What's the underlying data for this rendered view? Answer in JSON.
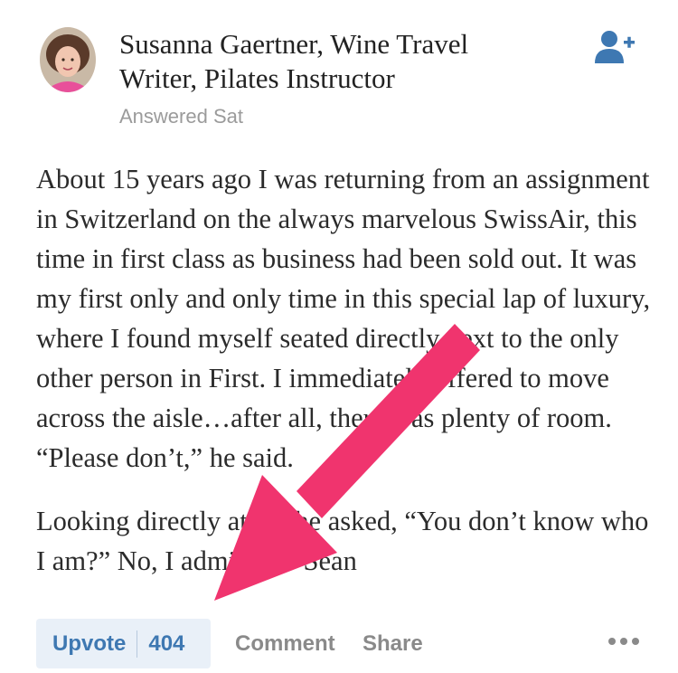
{
  "author": {
    "name": "Susanna Gaertner, Wine Travel Writer, Pilates Instructor",
    "answered": "Answered Sat"
  },
  "icons": {
    "follow": "add-user-icon",
    "more": "more-horizontal-icon"
  },
  "answer": {
    "paragraphs": [
      "About 15 years ago I was returning from an assignment in Switzerland on the always marvelous SwissAir, this time in first class as business had been sold out. It was my first only and only time in this special lap of luxury, where I found myself seated directly next to the only other person in First. I immediately offered to move across the aisle…after all, there was plenty of room. “Please don’t,” he said.",
      "Looking directly at me he asked, “You don’t know who I am?” No, I admitted. ”Sean"
    ]
  },
  "actions": {
    "upvote_label": "Upvote",
    "upvote_count": "404",
    "comment_label": "Comment",
    "share_label": "Share"
  },
  "colors": {
    "accent": "#3e78b2",
    "upvote_bg": "#e9f0f8",
    "arrow": "#f0346e",
    "muted": "#9b9b9b"
  }
}
